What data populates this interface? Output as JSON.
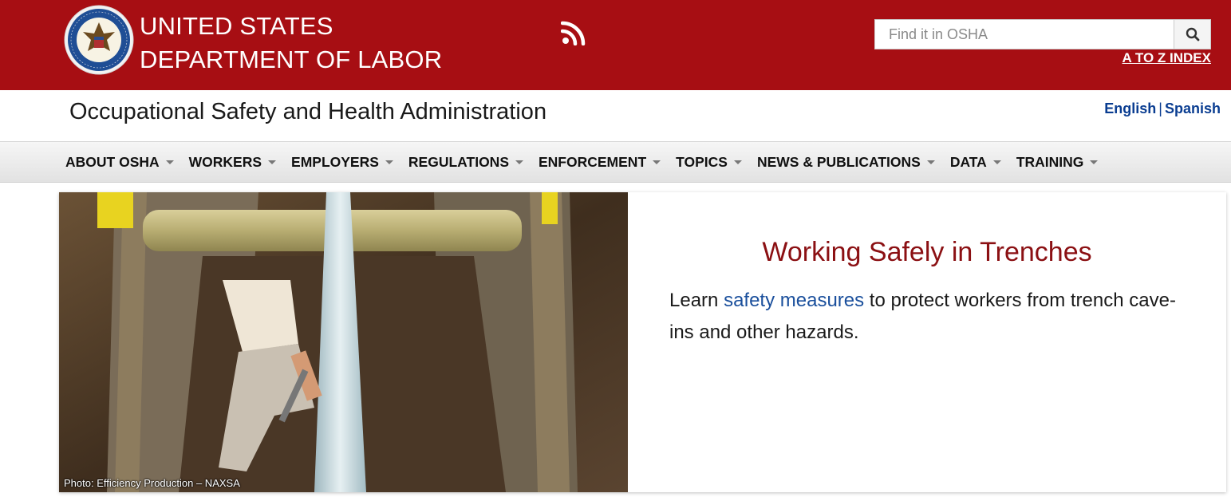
{
  "banner": {
    "title_line1": "UNITED STATES",
    "title_line2": "DEPARTMENT OF LABOR",
    "rss_icon": "rss-icon",
    "search": {
      "placeholder": "Find it in OSHA",
      "value": "",
      "button_icon": "search-icon"
    },
    "az_index": "A TO Z INDEX",
    "colors": {
      "banner_bg": "#a70e13"
    }
  },
  "agency": {
    "name": "Occupational Safety and Health Administration",
    "languages": [
      "English",
      "Spanish"
    ],
    "separator": "|"
  },
  "nav": {
    "items": [
      "ABOUT OSHA",
      "WORKERS",
      "EMPLOYERS",
      "REGULATIONS",
      "ENFORCEMENT",
      "TOPICS",
      "NEWS & PUBLICATIONS",
      "DATA",
      "TRAINING"
    ]
  },
  "hero": {
    "title": "Working Safely in Trenches",
    "text_before": "Learn ",
    "link": "safety measures",
    "text_after": " to protect workers from trench cave-ins and other hazards.",
    "photo_credit": "Photo: Efficiency Production – NAXSA",
    "colors": {
      "title": "#8b1013",
      "link": "#1a4f9c"
    }
  }
}
